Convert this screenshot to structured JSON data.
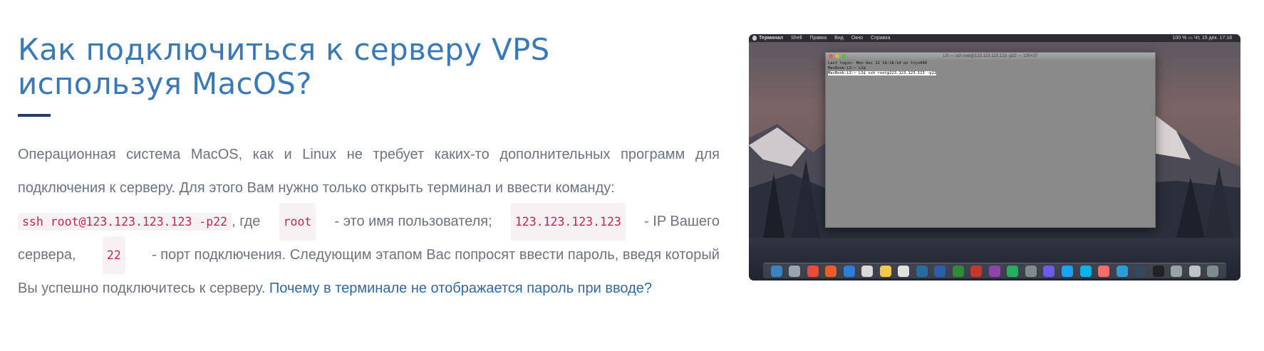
{
  "article": {
    "title_line1": "Как подключиться к серверу VPS",
    "title_line2": "используя MacOS?",
    "p1a": "Операционная система MacOS, как и Linux не требует каких-то дополнительных программ для",
    "p1b": "подключения к серверу. Для этого Вам нужно только открыть терминал и ввести команду:",
    "code_cmd": "ssh root@123.123.123.123 -p22",
    "t_gde": ", где",
    "code_user": "root",
    "t_user_desc": "- это имя пользователя;",
    "code_ip": "123.123.123.123",
    "t_ip_desc": "- IP Вашего",
    "t_server": "сервера,",
    "code_port": "22",
    "t_port_desc": "- порт подключения. Следующим этапом Вас попросят ввести пароль, введя который",
    "t_final": "Вы успешно подключитесь к серверу.",
    "link_text": "Почему в терминале не отображается пароль при вводе?"
  },
  "screenshot": {
    "menubar_items": [
      "Терминал",
      "Shell",
      "Правка",
      "Вид",
      "Окно",
      "Справка"
    ],
    "menubar_right": "100 % ▭   Чт, 15 дек. 17:18",
    "terminal_title": "LS — ssh root@123.123.123.123 -p22 — 130×37",
    "terminal_lines": [
      "Last login: Mon Dec 12 18:18:14 on ttys000",
      "MacBook-LS:~ LS$",
      "MacBook-LS:~ LS$ ssh root@123.123.123.123 -p22"
    ],
    "dock_colors": [
      "#3b82c4",
      "#9aa4b0",
      "#e74c3c",
      "#e85d2a",
      "#2e7dd8",
      "#d9d9d9",
      "#f2c94c",
      "#e0e0e0",
      "#2b6a9f",
      "#2a5fb0",
      "#2e8b3c",
      "#c0392b",
      "#8e44ad",
      "#27ae60",
      "#7f8c8d",
      "#6c5ce7",
      "#1da1f2",
      "#0db3e8",
      "#ff6b6b",
      "#2d9cdb",
      "#34495e",
      "#222222",
      "#95a5a6",
      "#bdc3c7",
      "#7f8c8d"
    ]
  }
}
